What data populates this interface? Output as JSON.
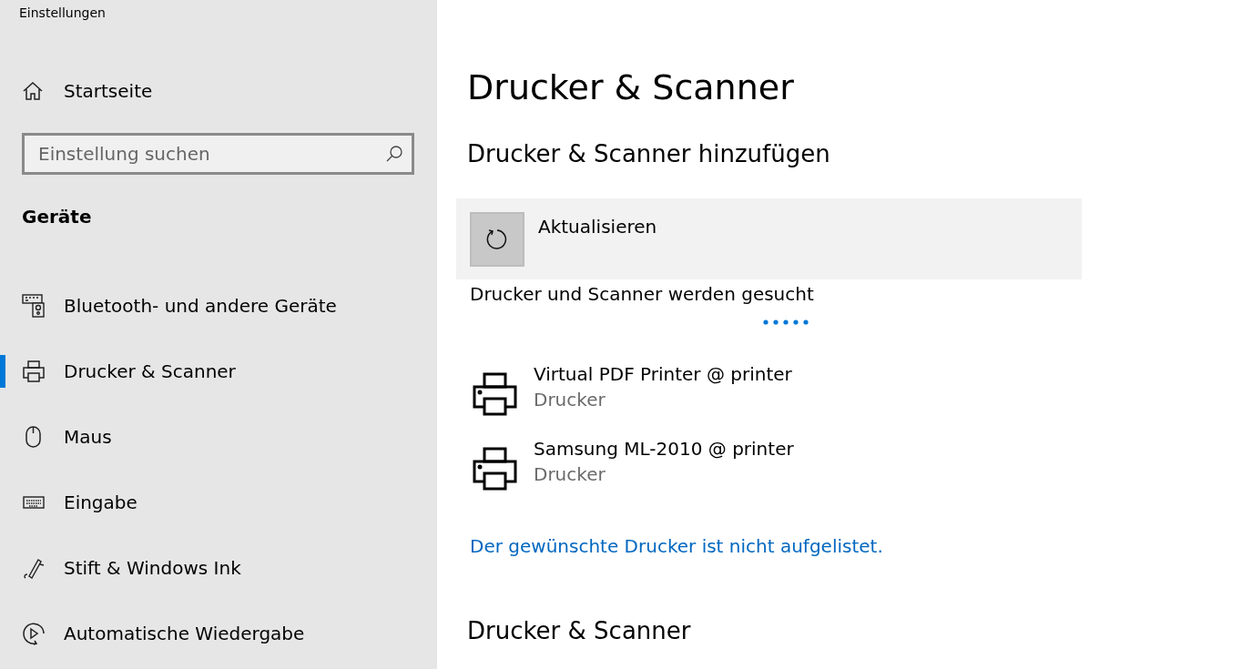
{
  "window": {
    "title": "Einstellungen"
  },
  "sidebar": {
    "home": {
      "label": "Startseite"
    },
    "search": {
      "placeholder": "Einstellung suchen"
    },
    "section": "Geräte",
    "items": [
      {
        "label": "Bluetooth- und andere Geräte",
        "selected": false
      },
      {
        "label": "Drucker & Scanner",
        "selected": true
      },
      {
        "label": "Maus",
        "selected": false
      },
      {
        "label": "Eingabe",
        "selected": false
      },
      {
        "label": "Stift & Windows Ink",
        "selected": false
      },
      {
        "label": "Automatische Wiedergabe",
        "selected": false
      }
    ]
  },
  "main": {
    "title": "Drucker & Scanner",
    "add_heading": "Drucker & Scanner hinzufügen",
    "refresh": {
      "label": "Aktualisieren"
    },
    "status": "Drucker und Scanner werden gesucht",
    "printers": [
      {
        "name": "Virtual PDF Printer @ printer",
        "type": "Drucker"
      },
      {
        "name": "Samsung ML-2010 @ printer",
        "type": "Drucker"
      }
    ],
    "link": "Der gewünschte Drucker ist nicht aufgelistet.",
    "list_heading": "Drucker & Scanner"
  }
}
